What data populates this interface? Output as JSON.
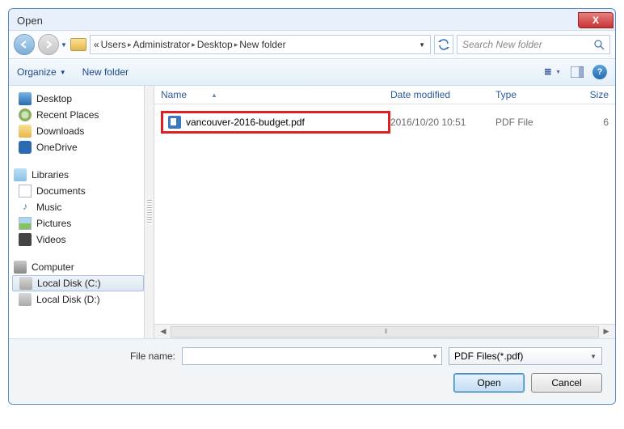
{
  "title": "Open",
  "breadcrumb": {
    "prefix": "«",
    "parts": [
      "Users",
      "Administrator",
      "Desktop",
      "New folder"
    ]
  },
  "search_placeholder": "Search New folder",
  "toolbar": {
    "organize": "Organize",
    "newfolder": "New folder"
  },
  "columns": {
    "name": "Name",
    "date": "Date modified",
    "type": "Type",
    "size": "Size"
  },
  "sidebar": {
    "favorites": [
      {
        "label": "Desktop",
        "icon": "ico-monitor"
      },
      {
        "label": "Recent Places",
        "icon": "ico-clock"
      },
      {
        "label": "Downloads",
        "icon": "ico-dl"
      },
      {
        "label": "OneDrive",
        "icon": "ico-cloud"
      }
    ],
    "libraries_head": "Libraries",
    "libraries": [
      {
        "label": "Documents",
        "icon": "ico-doc"
      },
      {
        "label": "Music",
        "icon": "ico-music"
      },
      {
        "label": "Pictures",
        "icon": "ico-pic"
      },
      {
        "label": "Videos",
        "icon": "ico-vid"
      }
    ],
    "computer_head": "Computer",
    "computer": [
      {
        "label": "Local Disk (C:)",
        "icon": "ico-disk",
        "selected": true
      },
      {
        "label": "Local Disk (D:)",
        "icon": "ico-disk"
      }
    ]
  },
  "files": [
    {
      "name": "vancouver-2016-budget.pdf",
      "date": "2016/10/20 10:51",
      "type": "PDF File",
      "size": "6"
    }
  ],
  "bottom": {
    "filename_label": "File name:",
    "filetype": "PDF Files(*.pdf)",
    "open": "Open",
    "cancel": "Cancel"
  }
}
